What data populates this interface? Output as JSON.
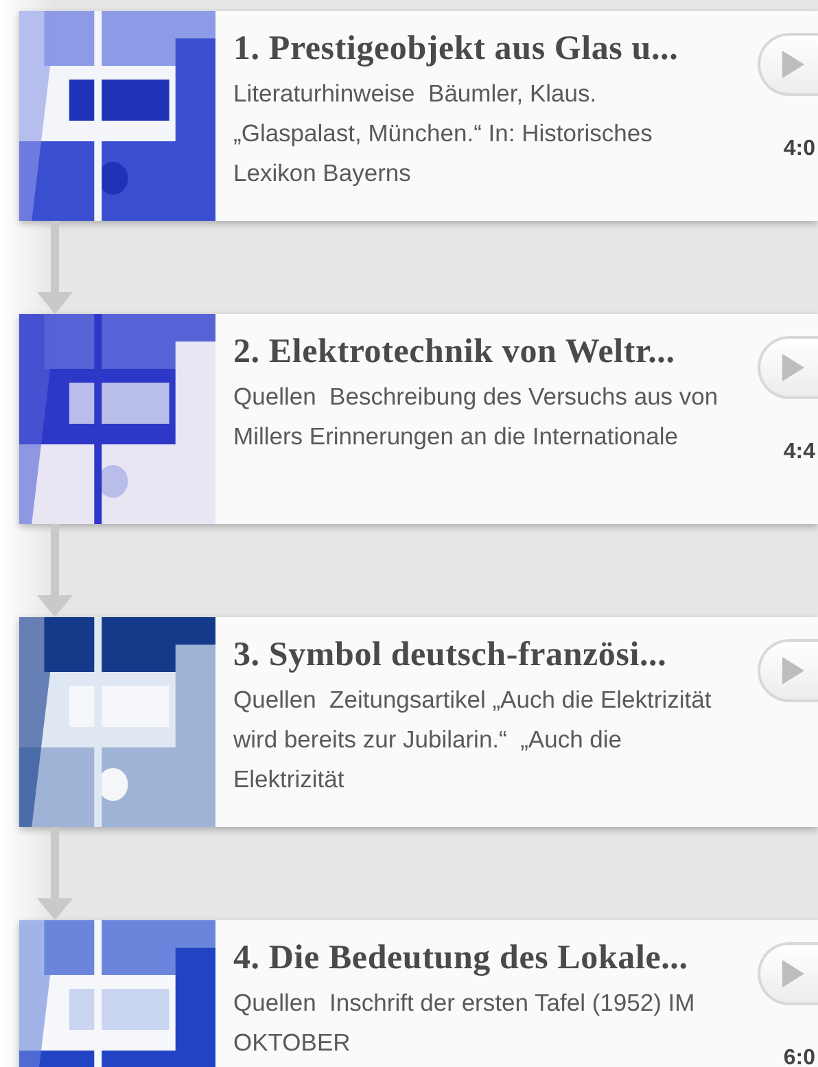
{
  "items": [
    {
      "title": "1. Prestigeobjekt aus Glas u...",
      "text": "Literaturhinweise  Bäumler, Klaus. „Glaspalast, München.“ In: Historisches Lexikon Bayerns",
      "duration": "4:0"
    },
    {
      "title": "2. Elektrotechnik von Weltr...",
      "text": "Quellen  Beschreibung des Versuchs aus von Millers Erinnerungen an die Internationale",
      "duration": "4:4"
    },
    {
      "title": "3. Symbol deutsch-französi...",
      "text": "Quellen  Zeitungsartikel „Auch die Elektrizität wird bereits zur Jubilarin.“  „Auch die Elektrizität"
    },
    {
      "title": "4. Die Bedeutung des Lokale...",
      "text": "Quellen  Inschrift der ersten Tafel (1952) IM OKTOBER",
      "duration": "6:0"
    }
  ]
}
